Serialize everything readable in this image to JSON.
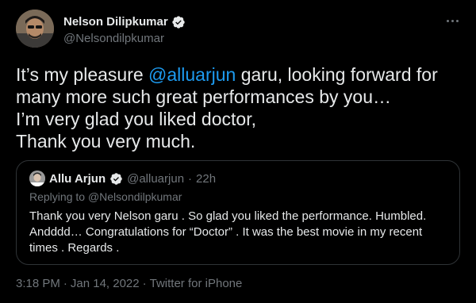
{
  "author": {
    "name": "Nelson Dilipkumar",
    "handle": "@Nelsondilpkumar"
  },
  "tweet": {
    "line1_before": "It’s my pleasure ",
    "line1_mention": "@alluarjun",
    "line1_after": " garu, looking forward for",
    "line2": "many more such great performances by you…",
    "line3": "I’m very glad you liked doctor,",
    "line4": "Thank you very much."
  },
  "quote": {
    "name": "Allu Arjun",
    "handle": "@alluarjun",
    "separator": "·",
    "time": "22h",
    "replying_prefix": "Replying to ",
    "replying_handle": "@Nelsondilpkumar",
    "line1": "Thank you very Nelson garu . So glad you liked the performance. Humbled.",
    "line2": "Andddd… Congratulations for “Doctor” . It was the best movie in my recent",
    "line3": "times . Regards ."
  },
  "meta": {
    "time": "3:18 PM",
    "separator1": "·",
    "date": "Jan 14, 2022",
    "separator2": "·",
    "source": "Twitter for iPhone"
  },
  "icons": {
    "verified": "verified-badge-icon",
    "more": "more-options-icon"
  },
  "colors": {
    "background": "#000000",
    "text": "#e7e9ea",
    "secondary": "#71767b",
    "link": "#1d9bf0",
    "border": "#2f3336"
  }
}
